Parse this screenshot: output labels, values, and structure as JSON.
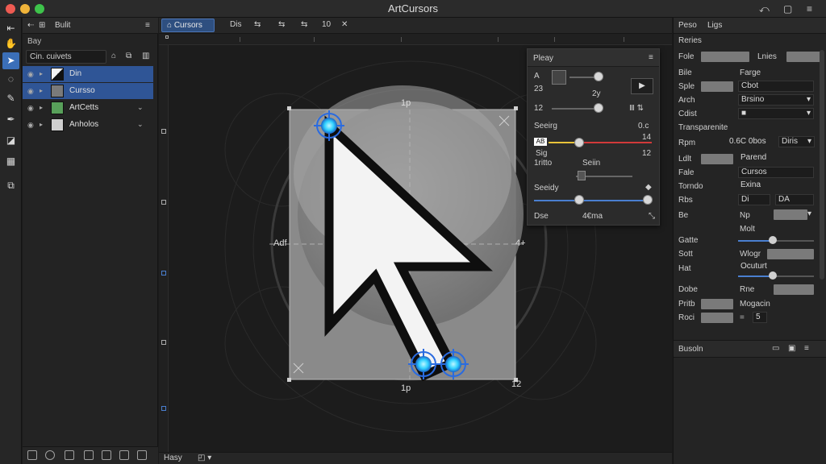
{
  "window": {
    "title": "ArtCursors"
  },
  "layers_panel": {
    "tab_a": "Bulit",
    "subtitle": "Bay",
    "search_value": "Cin. cuivets",
    "layers": [
      {
        "name": "Din",
        "thumb_color": "#f2f2f2",
        "selected": true
      },
      {
        "name": "Cursso",
        "thumb_color": "#7a7a7a",
        "selected": true
      },
      {
        "name": "ArtCetts",
        "thumb_color": "#58a05a",
        "selected": false
      },
      {
        "name": "Anholos",
        "thumb_color": "#cfcfcf",
        "selected": false
      }
    ]
  },
  "doc_toolbar": {
    "tab_label": "Cursors",
    "item_1": "Dis",
    "item_2": "10"
  },
  "canvas": {
    "label_top": "1p",
    "label_bottom": "1p",
    "label_left": "Adf",
    "label_right": "4+",
    "label_bottom_right": "12"
  },
  "status": {
    "label": "Hasy"
  },
  "float_panel": {
    "title": "Pleay",
    "row_a_label": "A",
    "row_a_value": "23",
    "row_b_value": "2y",
    "row_c_label": "12",
    "section_1": "Seeirg",
    "section_1_value": "0.c",
    "ab_label": "AB",
    "row_d_label": "Sig",
    "row_d_value": "12",
    "row_d_right": "14",
    "row_e_label": "1ritto",
    "row_e_value": "Seiin",
    "section_2": "Seeidy",
    "row_f_label": "Dse",
    "row_f_value": "4€ma"
  },
  "properties_panel": {
    "tab_a": "Peso",
    "tab_b": "Ligs",
    "header": "Reries",
    "rows": [
      {
        "label": "Fole",
        "right_label": "Lnies"
      },
      {
        "label": "Bile",
        "right_label": "Farge"
      },
      {
        "label": "Sple",
        "field": "Cbot"
      },
      {
        "label": "Arch",
        "field": "Brsino"
      },
      {
        "label": "Cdist",
        "field": "■"
      },
      {
        "label": "Transparenite"
      },
      {
        "label": "Rpm",
        "field_a": "0.6C 0bos",
        "field_b": "Diris"
      },
      {
        "label": "Ldlt",
        "field": "Parend"
      },
      {
        "label": "Fale",
        "field": "Cursos"
      },
      {
        "label": "Torndo",
        "field": "Exina"
      },
      {
        "label": "Rbs",
        "field_a": "Di",
        "field_b": "DA"
      },
      {
        "label": "Be",
        "right_label": "Np"
      },
      {
        "label": "Molt"
      },
      {
        "label": "Gatte"
      },
      {
        "label": "Sott",
        "right_label": "Wlogr"
      },
      {
        "label": "Hat",
        "field": "Ocuturt"
      },
      {
        "label": "Dobe",
        "right_label": "Rne"
      },
      {
        "label": "Pritb",
        "right_label": "Mogacin"
      },
      {
        "label": "Roci",
        "right_label": "=",
        "field": "5"
      }
    ],
    "footer_section": "Busoln"
  },
  "colors": {
    "accent": "#3b6fb8",
    "selection": "#2f5596",
    "handle": "#32d2ff",
    "red_slider": "#d23a3a",
    "yellow_slider": "#e8c33a"
  }
}
